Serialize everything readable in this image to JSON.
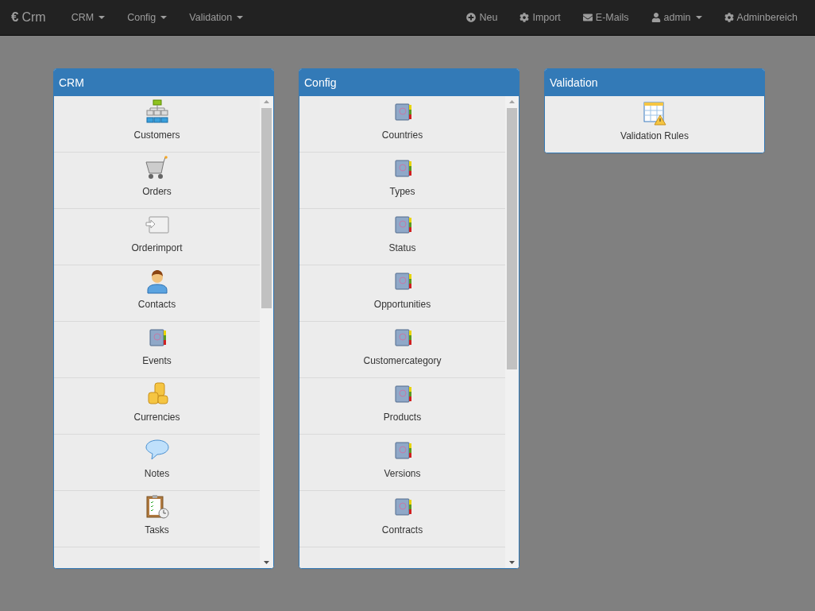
{
  "navbar": {
    "brand": {
      "symbol": "€",
      "text": "Crm"
    },
    "menus": [
      {
        "label": "CRM"
      },
      {
        "label": "Config"
      },
      {
        "label": "Validation"
      }
    ],
    "right": [
      {
        "kind": "plus",
        "label": "Neu",
        "dropdown": false
      },
      {
        "kind": "gear",
        "label": "Import",
        "dropdown": false
      },
      {
        "kind": "mail",
        "label": "E-Mails",
        "dropdown": false
      },
      {
        "kind": "user",
        "label": "admin",
        "dropdown": true
      },
      {
        "kind": "gear",
        "label": "Adminbereich",
        "dropdown": false
      }
    ]
  },
  "panels": [
    {
      "title": "CRM",
      "scroll": true,
      "items": [
        {
          "kind": "org-chart",
          "label": "Customers"
        },
        {
          "kind": "cart",
          "label": "Orders"
        },
        {
          "kind": "import",
          "label": "Orderimport"
        },
        {
          "kind": "person",
          "label": "Contacts"
        },
        {
          "kind": "book",
          "label": "Events"
        },
        {
          "kind": "coins",
          "label": "Currencies"
        },
        {
          "kind": "speech",
          "label": "Notes"
        },
        {
          "kind": "tasks",
          "label": "Tasks"
        }
      ]
    },
    {
      "title": "Config",
      "scroll": true,
      "items": [
        {
          "kind": "book",
          "label": "Countries"
        },
        {
          "kind": "book",
          "label": "Types"
        },
        {
          "kind": "book",
          "label": "Status"
        },
        {
          "kind": "book",
          "label": "Opportunities"
        },
        {
          "kind": "book",
          "label": "Customercategory"
        },
        {
          "kind": "book",
          "label": "Products"
        },
        {
          "kind": "book",
          "label": "Versions"
        },
        {
          "kind": "book",
          "label": "Contracts"
        }
      ]
    },
    {
      "title": "Validation",
      "scroll": false,
      "items": [
        {
          "kind": "table-warning",
          "label": "Validation Rules"
        }
      ]
    }
  ]
}
